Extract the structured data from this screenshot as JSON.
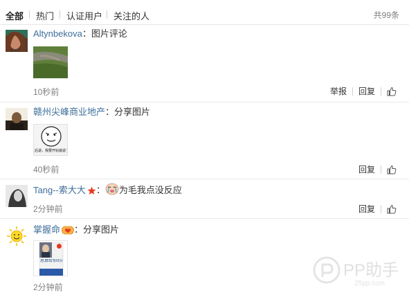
{
  "tabs": {
    "items": [
      {
        "label": "全部"
      },
      {
        "label": "热门"
      },
      {
        "label": "认证用户"
      },
      {
        "label": "关注的人"
      }
    ],
    "total": "共99条"
  },
  "comments": [
    {
      "user": "Altynbekova",
      "colon": "：",
      "text": "图片评论",
      "time": "10秒前",
      "report": "举报",
      "reply": "回复"
    },
    {
      "user": "赣州尖峰商业地产",
      "colon": "：",
      "text": "分享图片",
      "meme_caption": "后退，我要开始装逼了",
      "time": "40秒前",
      "reply": "回复"
    },
    {
      "user": "Tang--索大大",
      "colon": "：",
      "text": "为毛我点没反应",
      "time": "2分钟前",
      "reply": "回复"
    },
    {
      "user": "掌握命",
      "colon": "：",
      "text": "分享图片",
      "time": "2分钟前",
      "book_title": "总算给你的礼物"
    }
  ],
  "watermark": {
    "brand": "PP助手",
    "url": "25pp.com"
  },
  "icons": {
    "like": "thumbs-up-icon",
    "star": "red-star-icon",
    "emoji": "crying-face-icon",
    "medal": "yellow-medal-icon"
  },
  "colors": {
    "username": "#3d6e9a",
    "meta": "#808080",
    "divider": "#e9e9e9"
  }
}
